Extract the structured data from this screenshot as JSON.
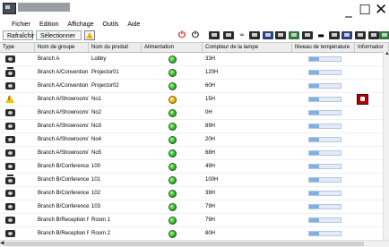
{
  "window": {
    "title": "",
    "controls": [
      "_",
      "☐",
      "✕"
    ]
  },
  "menu": [
    "Fichier",
    "Edition",
    "Affichage",
    "Outils",
    "Aide"
  ],
  "toolbar": {
    "refresh_label": "Rafraîchir",
    "select_all_label": "Sélectionner tout"
  },
  "columns": [
    "Type",
    "Nom de groupe",
    "Nom du produit",
    "Alimentation",
    "Compteur de la lampe",
    "Niveau de température",
    "Informatior"
  ],
  "rows": [
    {
      "type": "projector",
      "group": "Branch A",
      "product": "Lobby",
      "power": "on",
      "lamp": "33H",
      "temp": 0.3,
      "info": false
    },
    {
      "type": "projector-ceiling",
      "group": "Branch A/Convention H",
      "product": "Projector01",
      "power": "on",
      "lamp": "120H",
      "temp": 0.3,
      "info": false
    },
    {
      "type": "projector",
      "group": "Branch A/Convention H",
      "product": "Projector02",
      "power": "on",
      "lamp": "60H",
      "temp": 0.3,
      "info": false
    },
    {
      "type": "warning",
      "group": "Branch A/Showroom/Sl",
      "product": "No1",
      "power": "warning",
      "lamp": "15H",
      "temp": 0.3,
      "info": true
    },
    {
      "type": "projector",
      "group": "Branch A/Showroom/Sl",
      "product": "No2",
      "power": "on",
      "lamp": "0H",
      "temp": 0.3,
      "info": false
    },
    {
      "type": "projector",
      "group": "Branch A/Showroom/Sl",
      "product": "No3",
      "power": "on",
      "lamp": "89H",
      "temp": 0.3,
      "info": false
    },
    {
      "type": "projector",
      "group": "Branch A/Showroom/Sl",
      "product": "No4",
      "power": "on",
      "lamp": "20H",
      "temp": 0.3,
      "info": false
    },
    {
      "type": "projector",
      "group": "Branch A/Showroom/Sl",
      "product": "No5",
      "power": "on",
      "lamp": "68H",
      "temp": 0.3,
      "info": false
    },
    {
      "type": "projector",
      "group": "Branch B/Conference F",
      "product": "100",
      "power": "on",
      "lamp": "49H",
      "temp": 0.3,
      "info": false
    },
    {
      "type": "projector-ceiling",
      "group": "Branch B/Conference F",
      "product": "101",
      "power": "on",
      "lamp": "100H",
      "temp": 0.3,
      "info": false
    },
    {
      "type": "projector",
      "group": "Branch B/Conference F",
      "product": "102",
      "power": "on",
      "lamp": "39H",
      "temp": 0.3,
      "info": false
    },
    {
      "type": "projector",
      "group": "Branch B/Conference F",
      "product": "103",
      "power": "on",
      "lamp": "79H",
      "temp": 0.3,
      "info": false
    },
    {
      "type": "projector",
      "group": "Branch B/Reception Rc",
      "product": "Room 1",
      "power": "on",
      "lamp": "79H",
      "temp": 0.3,
      "info": false
    },
    {
      "type": "projector",
      "group": "Branch B/Reception Rc",
      "product": "Room 2",
      "power": "on",
      "lamp": "80H",
      "temp": 0.3,
      "info": false
    }
  ],
  "colors": {
    "power_on": "#35c22a",
    "power_warning": "#f0b800",
    "temp_fill": "#7db0e6",
    "info_alert": "#b40000"
  }
}
